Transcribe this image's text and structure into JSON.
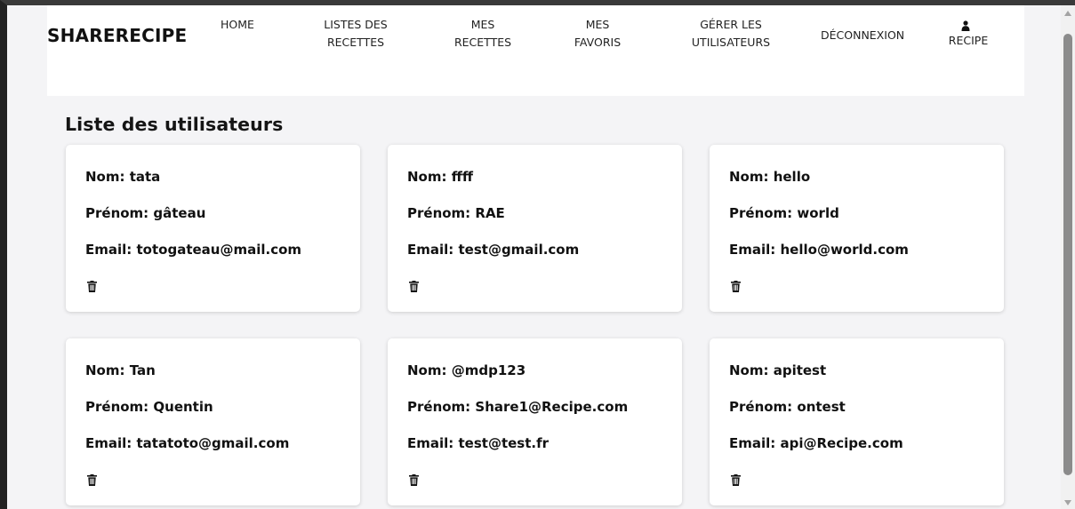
{
  "navbar": {
    "brand": "SHARERECIPE",
    "items": [
      {
        "label": "HOME"
      },
      {
        "label": "LISTES DES\nRECETTES"
      },
      {
        "label": "MES\nRECETTES"
      },
      {
        "label": "MES\nFAVORIS"
      },
      {
        "label": "GÉRER LES\nUTILISATEURS"
      },
      {
        "label": "DÉCONNEXION"
      }
    ],
    "user": {
      "icon": "user-icon",
      "label": "RECIPE"
    }
  },
  "main": {
    "title": "Liste des utilisateurs",
    "users": [
      {
        "nom": "Nom: tata",
        "prenom": "Prénom: gâteau",
        "email": "Email: totogateau@mail.com",
        "action_icon": "trash-icon"
      },
      {
        "nom": "Nom: ffff",
        "prenom": "Prénom: RAE",
        "email": "Email: test@gmail.com",
        "action_icon": "trash-icon"
      },
      {
        "nom": "Nom: hello",
        "prenom": "Prénom: world",
        "email": "Email: hello@world.com",
        "action_icon": "trash-icon"
      },
      {
        "nom": "Nom: Tan",
        "prenom": "Prénom: Quentin",
        "email": "Email: tatatoto@gmail.com",
        "action_icon": "trash-icon"
      },
      {
        "nom": "Nom: @mdp123",
        "prenom": "Prénom: Share1@Recipe.com",
        "email": "Email: test@test.fr",
        "action_icon": "trash-icon"
      },
      {
        "nom": "Nom: apitest",
        "prenom": "Prénom: ontest",
        "email": "Email: api@Recipe.com",
        "action_icon": "trash-icon"
      }
    ]
  },
  "colors": {
    "page_background": "#f4f4f6",
    "card_background": "#ffffff",
    "navbar_background": "#ffffff",
    "text": "#111111"
  }
}
